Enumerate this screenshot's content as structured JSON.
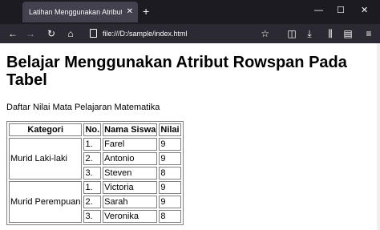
{
  "browser": {
    "tab_title": "Latihan Menggunakan Atribut Rowspan Pad",
    "tab_close": "✕",
    "new_tab": "+",
    "url": "file:///D:/sample/index.html",
    "controls": {
      "minimize": "—",
      "maximize": "☐",
      "close": "✕"
    }
  },
  "page": {
    "title": "Belajar Menggunakan Atribut Rowspan Pada Tabel",
    "subtitle": "Daftar Nilai Mata Pelajaran Matematika",
    "table": {
      "headers": [
        "Kategori",
        "No.",
        "Nama Siswa",
        "Nilai"
      ],
      "groups": [
        {
          "category": "Murid Laki-laki",
          "rows": [
            {
              "no": "1.",
              "name": "Farel",
              "score": "9"
            },
            {
              "no": "2.",
              "name": "Antonio",
              "score": "9"
            },
            {
              "no": "3.",
              "name": "Steven",
              "score": "8"
            }
          ]
        },
        {
          "category": "Murid Perempuan",
          "rows": [
            {
              "no": "1.",
              "name": "Victoria",
              "score": "9"
            },
            {
              "no": "2.",
              "name": "Sarah",
              "score": "9"
            },
            {
              "no": "3.",
              "name": "Veronika",
              "score": "8"
            }
          ]
        }
      ]
    }
  }
}
